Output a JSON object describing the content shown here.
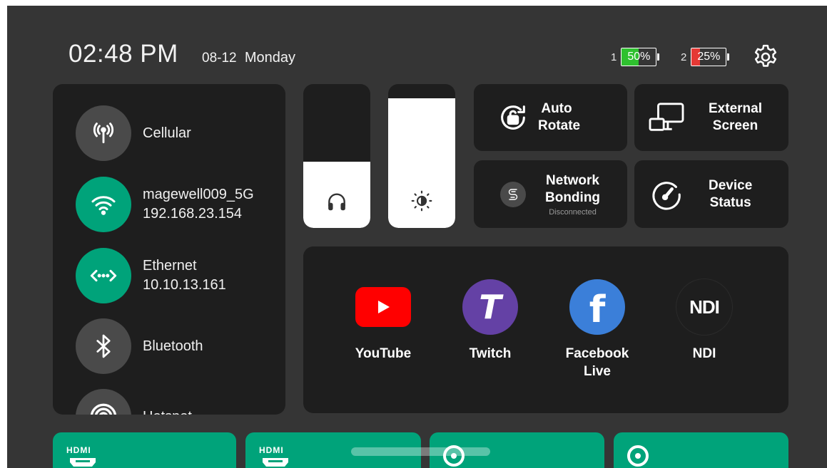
{
  "status_bar": {
    "time": "02:48 PM",
    "date": "08-12",
    "weekday": "Monday",
    "batteries": [
      {
        "index": "1",
        "percent_label": "50%",
        "level": 0.5,
        "color": "#2fc12f"
      },
      {
        "index": "2",
        "percent_label": "25%",
        "level": 0.25,
        "color": "#e53935"
      }
    ],
    "settings_icon": "gear-icon"
  },
  "network": {
    "items": [
      {
        "label": "Cellular",
        "detail": "",
        "icon": "cellular-antenna-icon",
        "active": false
      },
      {
        "label": "magewell009_5G",
        "detail": "192.168.23.154",
        "icon": "wifi-icon",
        "active": true
      },
      {
        "label": "Ethernet",
        "detail": "10.10.13.161",
        "icon": "ethernet-icon",
        "active": true
      },
      {
        "label": "Bluetooth",
        "detail": "",
        "icon": "bluetooth-icon",
        "active": false
      },
      {
        "label": "Hotspot",
        "detail": "",
        "icon": "hotspot-icon",
        "active": false
      }
    ],
    "active_color": "#00a37a",
    "inactive_color": "#4a4a4a"
  },
  "sliders": {
    "volume": {
      "icon": "headphones-icon",
      "level": 0.46
    },
    "brightness": {
      "icon": "brightness-icon",
      "level": 0.9
    }
  },
  "tiles": {
    "auto_rotate": {
      "label_line1": "Auto",
      "label_line2": "Rotate",
      "icon": "rotate-lock-icon"
    },
    "external_screen": {
      "label_line1": "External",
      "label_line2": "Screen",
      "icon": "external-screen-icon"
    },
    "network_bonding": {
      "label_line1": "Network",
      "label_line2": "Bonding",
      "status": "Disconnected",
      "icon": "bonding-icon"
    },
    "device_status": {
      "label_line1": "Device",
      "label_line2": "Status",
      "icon": "gauge-icon"
    }
  },
  "apps": [
    {
      "name_line1": "YouTube",
      "name_line2": "",
      "icon": "youtube-icon",
      "color": "#ff0000"
    },
    {
      "name_line1": "Twitch",
      "name_line2": "",
      "icon": "twitch-icon",
      "color": "#6441a5"
    },
    {
      "name_line1": "Facebook",
      "name_line2": "Live",
      "icon": "facebook-icon",
      "color": "#3b7fd9"
    },
    {
      "name_line1": "NDI",
      "name_line2": "",
      "icon": "ndi-icon",
      "color": "#1e1e1e"
    }
  ],
  "sources": {
    "cards": [
      {
        "badge": "HDMI",
        "icon": "hdmi-icon"
      },
      {
        "badge": "HDMI",
        "icon": "hdmi-icon"
      },
      {
        "badge": "",
        "icon": "camera-source-icon"
      },
      {
        "badge": "",
        "icon": "camera-source-icon"
      }
    ],
    "color": "#00a37a"
  }
}
